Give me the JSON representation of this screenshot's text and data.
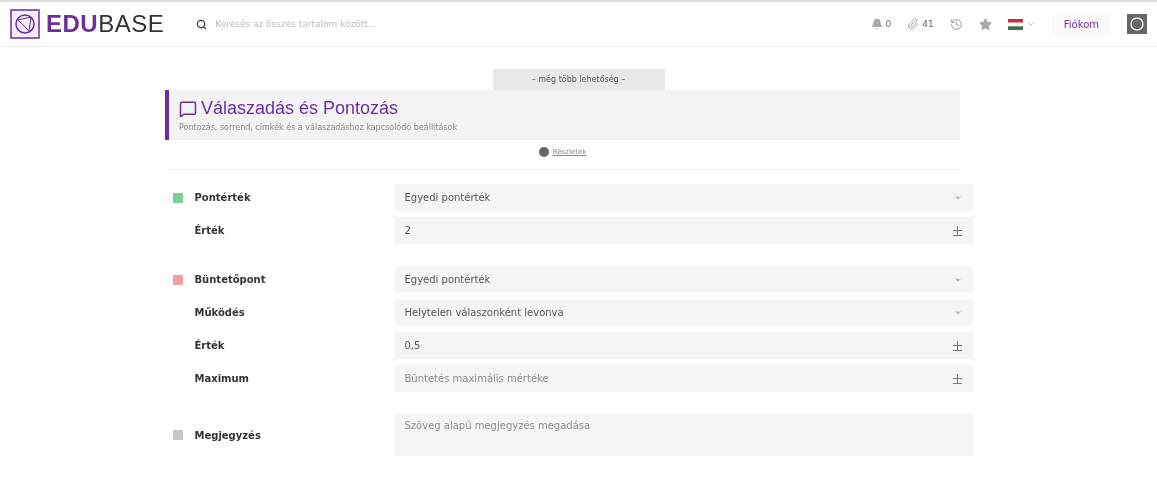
{
  "header": {
    "logo": {
      "bold": "EDU",
      "light": "BASE"
    },
    "search": {
      "placeholder": "Keresés az összes tartalom között..."
    },
    "notifications": "0",
    "attachments": "41",
    "account": "Fiókom"
  },
  "more_options": "– még több lehetőség –",
  "section": {
    "title": "Válaszadás és Pontozás",
    "subtitle": "Pontozás, sorrend, címkék és a válaszadáshoz kapcsolódó beállítások",
    "link": "Részletek"
  },
  "groups": [
    {
      "color": "#7ccf8c",
      "rows": [
        {
          "label": "Pontérték",
          "kind": "select",
          "value": "Egyedi pontérték"
        },
        {
          "label": "Érték",
          "kind": "number",
          "value": "2"
        }
      ]
    },
    {
      "color": "#f0a0a0",
      "rows": [
        {
          "label": "Büntetőpont",
          "kind": "select",
          "value": "Egyedi pontérték"
        },
        {
          "label": "Működés",
          "kind": "select",
          "value": "Helytelen válaszonként levonva"
        },
        {
          "label": "Érték",
          "kind": "number",
          "value": "0,5"
        },
        {
          "label": "Maximum",
          "kind": "number",
          "placeholder": "Büntetés maximális mértéke"
        }
      ]
    },
    {
      "color": "#c8c8c8",
      "rows": [
        {
          "label": "Megjegyzés",
          "kind": "textarea",
          "placeholder": "Szöveg alapú megjegyzés megadása"
        }
      ]
    }
  ]
}
